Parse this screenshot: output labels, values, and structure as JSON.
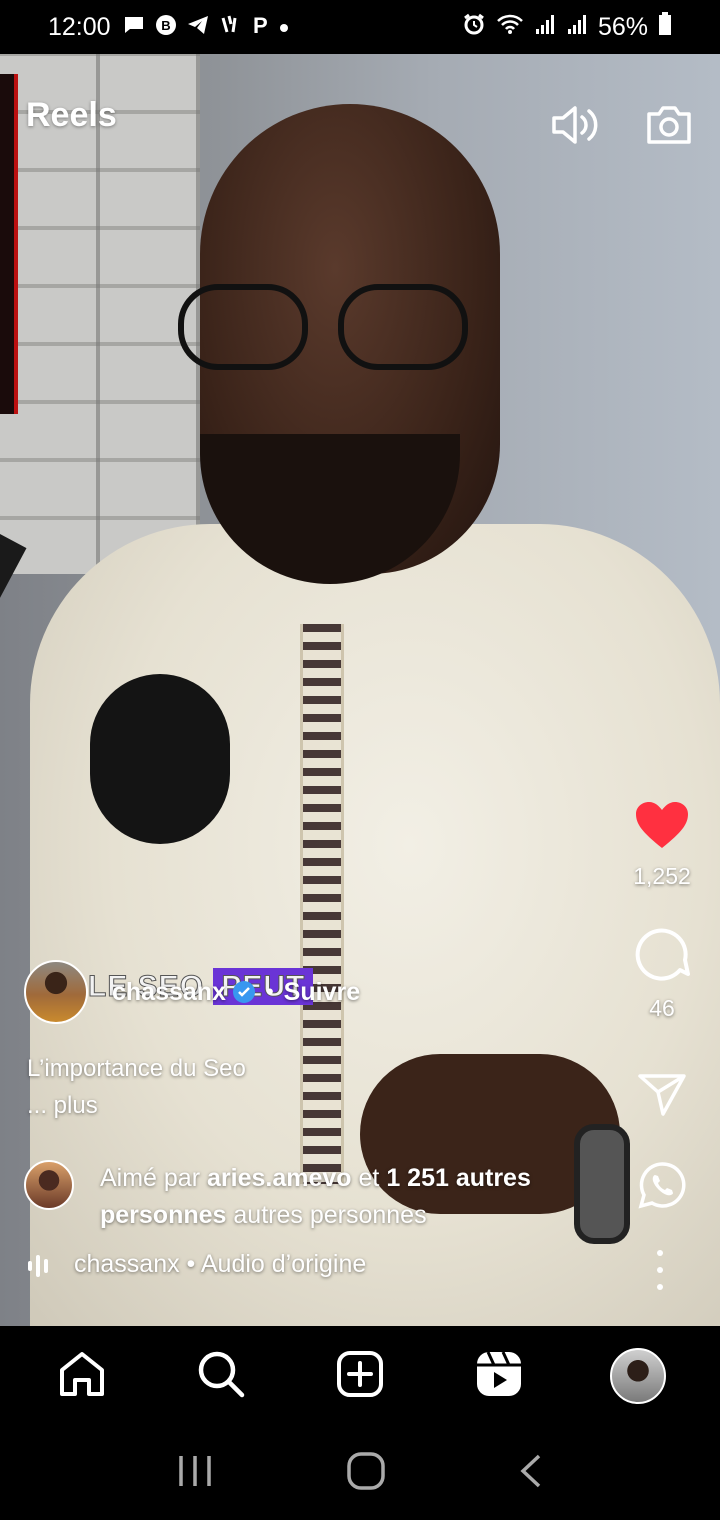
{
  "status_bar": {
    "time": "12:00",
    "battery": "56%",
    "left_icons": [
      "message-icon",
      "b-circle-icon",
      "telegram-icon",
      "vibration-icon",
      "p-icon",
      "dot-icon"
    ],
    "right_icons": [
      "alarm-icon",
      "wifi-icon",
      "signal-icon",
      "signal-icon",
      "battery-icon"
    ]
  },
  "header": {
    "title": "Reels",
    "icons": [
      "volume-icon",
      "camera-icon"
    ]
  },
  "rail": {
    "like_count": "1,252",
    "comment_count": "46",
    "icons": [
      "heart-icon",
      "comment-icon",
      "send-icon",
      "whatsapp-icon"
    ]
  },
  "post": {
    "username": "chassanx",
    "separator": "•",
    "follow_label": "Suivre",
    "video_overlay_text_a": "LE SEO",
    "video_overlay_text_b": "PEUT",
    "caption_line1": "L’importance du Seo",
    "caption_more": "... plus",
    "liked_prefix": "Aimé par",
    "liked_user": "aries.amevo",
    "liked_middle": "et",
    "liked_count": "1 251 autres",
    "liked_bold_2": "personnes",
    "liked_suffix": "autres personnes",
    "audio_label": "chassanx • Audio d’origine"
  },
  "bottom_nav": {
    "icons": [
      "home-icon",
      "search-icon",
      "create-icon",
      "reels-icon",
      "profile-avatar"
    ]
  },
  "system_nav": {
    "icons": [
      "recents-icon",
      "home-circle-icon",
      "back-icon"
    ]
  },
  "colors": {
    "like_red": "#ff3040",
    "verified_blue": "#3897f0",
    "overlay_purple": "#6a34d6"
  }
}
